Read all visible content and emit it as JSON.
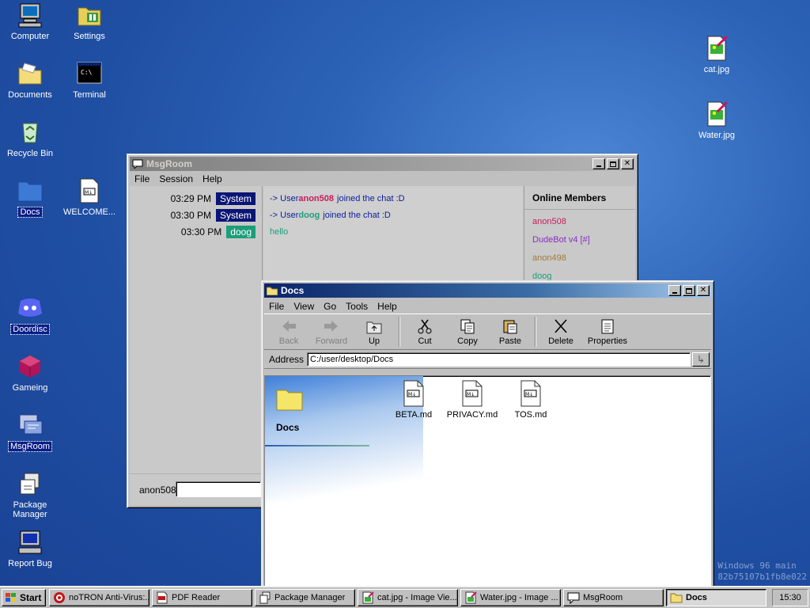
{
  "desktop": {
    "icons": [
      {
        "label": "Computer"
      },
      {
        "label": "Settings"
      },
      {
        "label": "Documents"
      },
      {
        "label": "Terminal"
      },
      {
        "label": "Recycle Bin"
      },
      {
        "label": "Docs"
      },
      {
        "label": "WELCOME..."
      },
      {
        "label": "Doordisc"
      },
      {
        "label": "Gameing"
      },
      {
        "label": "MsgRoom"
      },
      {
        "label": "Package Manager"
      },
      {
        "label": "Report Bug"
      },
      {
        "label": "cat.jpg"
      },
      {
        "label": "Water.jpg"
      }
    ],
    "watermark_line1": "Windows 96 main",
    "watermark_line2": "82b75107b1fb8e022"
  },
  "msgroom": {
    "title": "MsgRoom",
    "menu": [
      "File",
      "Session",
      "Help"
    ],
    "messages": [
      {
        "time": "03:29 PM",
        "sender": "System",
        "sender_color": "#0b1574",
        "prefix": "-> User ",
        "user": "anon508",
        "user_color": "#c81c5a",
        "suffix": " joined the chat :D"
      },
      {
        "time": "03:30 PM",
        "sender": "System",
        "sender_color": "#0b1574",
        "prefix": "-> User ",
        "user": "doog",
        "user_color": "#1c9e7a",
        "suffix": " joined the chat :D"
      },
      {
        "time": "03:30 PM",
        "sender": "doog",
        "sender_color": "#1c9e7a",
        "text": "hello",
        "text_color": "#1c9e7a"
      }
    ],
    "members_header": "Online Members",
    "members": [
      {
        "name": "anon508",
        "color": "#c81c5a"
      },
      {
        "name": "DudeBot v4 [#]",
        "color": "#8a2ec4"
      },
      {
        "name": "anon498",
        "color": "#a07a3c"
      },
      {
        "name": "doog",
        "color": "#1c9e7a"
      }
    ],
    "username": "anon508",
    "input_value": ""
  },
  "docs": {
    "title": "Docs",
    "menu": [
      "File",
      "View",
      "Go",
      "Tools",
      "Help"
    ],
    "toolbar": {
      "back": "Back",
      "forward": "Forward",
      "up": "Up",
      "cut": "Cut",
      "copy": "Copy",
      "paste": "Paste",
      "delete": "Delete",
      "properties": "Properties"
    },
    "address_label": "Address",
    "address_value": "C:/user/desktop/Docs",
    "folder_title": "Docs",
    "files": [
      "BETA.md",
      "PRIVACY.md",
      "TOS.md"
    ]
  },
  "taskbar": {
    "start": "Start",
    "tasks": [
      {
        "label": "noTRON Anti-Virus:..."
      },
      {
        "label": "PDF Reader"
      },
      {
        "label": "Package Manager"
      },
      {
        "label": "cat.jpg - Image Vie..."
      },
      {
        "label": "Water.jpg - Image ..."
      },
      {
        "label": "MsgRoom"
      },
      {
        "label": "Docs"
      }
    ],
    "clock": "15:30"
  }
}
